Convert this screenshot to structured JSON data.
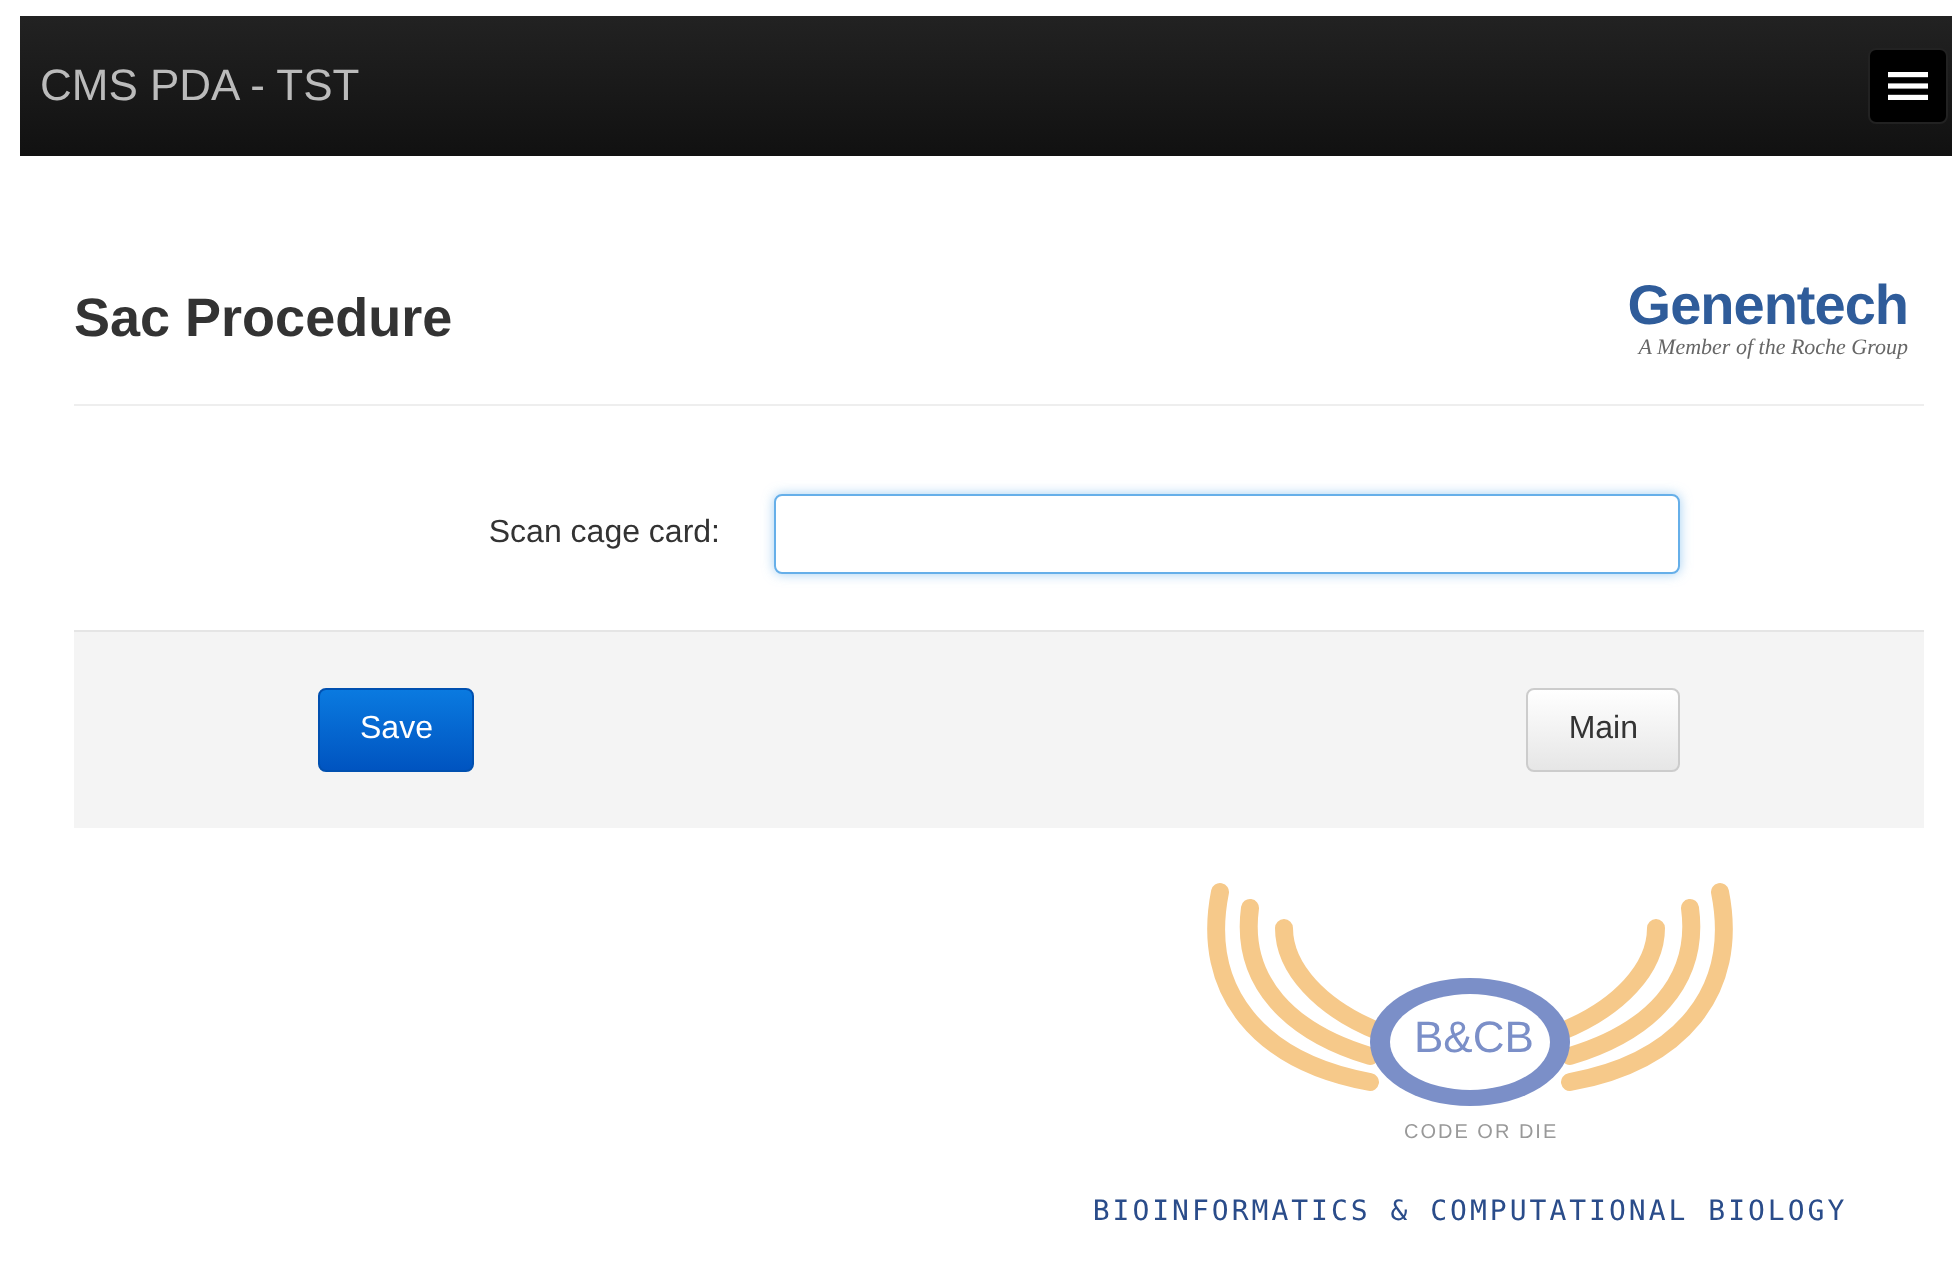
{
  "navbar": {
    "brand": "CMS PDA - TST"
  },
  "page": {
    "title": "Sac Procedure",
    "logo": {
      "name": "Genentech",
      "tagline": "A Member of the Roche Group"
    }
  },
  "form": {
    "label": "Scan cage card:",
    "focused": true
  },
  "buttons": [
    {
      "label": "Save",
      "kind": "primary"
    },
    {
      "label": "Main",
      "kind": "default"
    }
  ],
  "footer_logo": {
    "monogram": "B&CB",
    "motto": "CODE OR DIE",
    "caption": "BIOINFORMATICS & COMPUTATIONAL BIOLOGY"
  }
}
